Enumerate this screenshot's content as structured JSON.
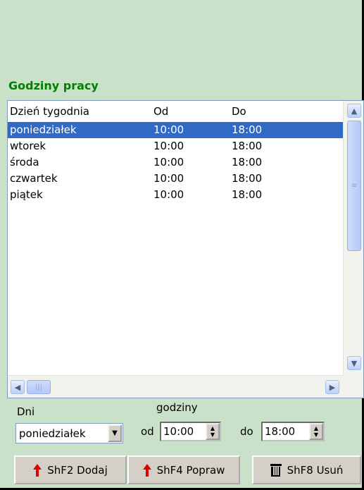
{
  "section_title": "Godziny pracy",
  "table": {
    "columns": [
      "Dzień tygodnia",
      "Od",
      "Do"
    ],
    "rows": [
      {
        "day": "poniedziałek",
        "from": "10:00",
        "to": "18:00",
        "selected": true
      },
      {
        "day": "wtorek",
        "from": "10:00",
        "to": "18:00",
        "selected": false
      },
      {
        "day": "środa",
        "from": "10:00",
        "to": "18:00",
        "selected": false
      },
      {
        "day": "czwartek",
        "from": "10:00",
        "to": "18:00",
        "selected": false
      },
      {
        "day": "piątek",
        "from": "10:00",
        "to": "18:00",
        "selected": false
      }
    ]
  },
  "form": {
    "days_label": "Dni",
    "hours_label": "godziny",
    "day_value": "poniedziałek",
    "from_label": "od",
    "from_value": "10:00",
    "to_label": "do",
    "to_value": "18:00"
  },
  "buttons": {
    "add": "ShF2 Dodaj",
    "edit": "ShF4 Popraw",
    "delete": "ShF8 Usuń"
  },
  "icons": {
    "add": "red-up-arrow-icon",
    "edit": "red-up-arrow-icon",
    "delete": "trash-icon",
    "scroll_up": "chevron-up-icon",
    "scroll_down": "chevron-down-icon",
    "scroll_left": "chevron-left-icon",
    "scroll_right": "chevron-right-icon"
  },
  "colors": {
    "background": "#c9e1c9",
    "title": "#008000",
    "selection": "#316ac5"
  }
}
